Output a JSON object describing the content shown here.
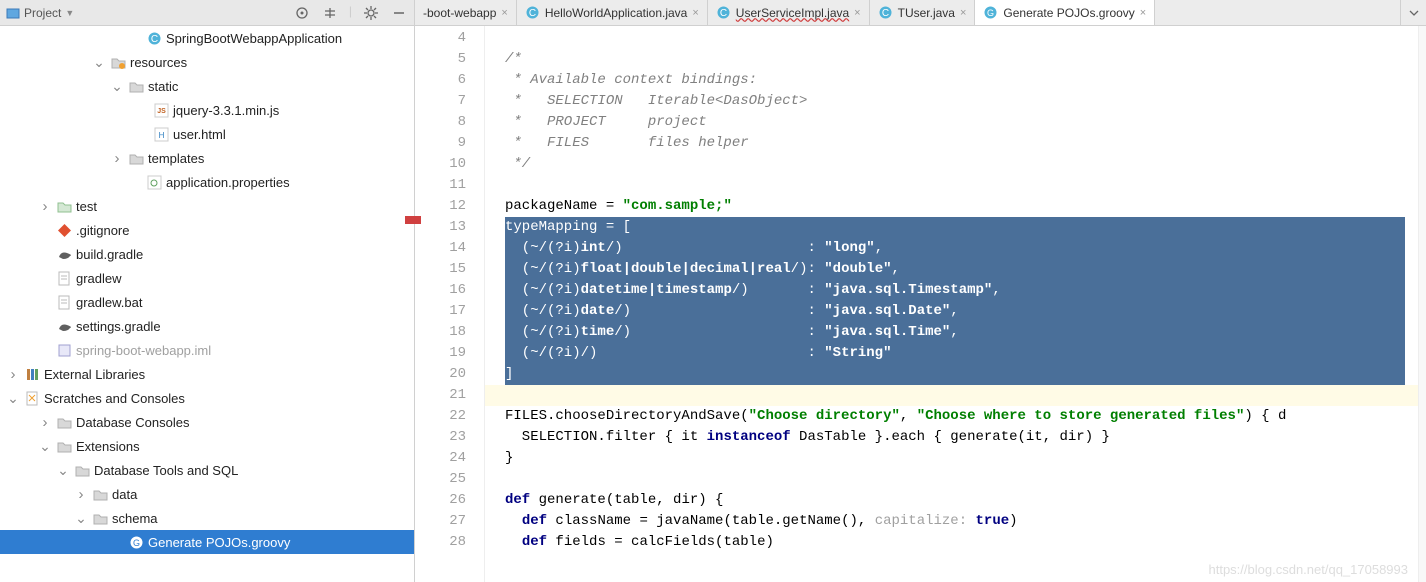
{
  "sidebar": {
    "title": "Project",
    "tree": [
      {
        "depth": 7,
        "icon": "class",
        "label": "SpringBootWebappApplication",
        "chevron": ""
      },
      {
        "depth": 5,
        "icon": "folder-res",
        "label": "resources",
        "chevron": "down"
      },
      {
        "depth": 6,
        "icon": "folder",
        "label": "static",
        "chevron": "down"
      },
      {
        "depth": 8,
        "icon": "js",
        "label": "jquery-3.3.1.min.js",
        "chevron": ""
      },
      {
        "depth": 8,
        "icon": "html",
        "label": "user.html",
        "chevron": ""
      },
      {
        "depth": 6,
        "icon": "folder",
        "label": "templates",
        "chevron": "right"
      },
      {
        "depth": 7,
        "icon": "props",
        "label": "application.properties",
        "chevron": ""
      },
      {
        "depth": 2,
        "icon": "folder-test",
        "label": "test",
        "chevron": "right"
      },
      {
        "depth": 2,
        "icon": "gitignore",
        "label": ".gitignore",
        "chevron": ""
      },
      {
        "depth": 2,
        "icon": "gradle",
        "label": "build.gradle",
        "chevron": ""
      },
      {
        "depth": 2,
        "icon": "file",
        "label": "gradlew",
        "chevron": ""
      },
      {
        "depth": 2,
        "icon": "file",
        "label": "gradlew.bat",
        "chevron": ""
      },
      {
        "depth": 2,
        "icon": "gradle",
        "label": "settings.gradle",
        "chevron": ""
      },
      {
        "depth": 2,
        "icon": "iml",
        "label": "spring-boot-webapp.iml",
        "chevron": "",
        "dim": true
      },
      {
        "depth": "root",
        "icon": "lib",
        "label": "External Libraries",
        "chevron": "right"
      },
      {
        "depth": "root",
        "icon": "scratch",
        "label": "Scratches and Consoles",
        "chevron": "down"
      },
      {
        "depth": 2,
        "icon": "folder",
        "label": "Database Consoles",
        "chevron": "right"
      },
      {
        "depth": 2,
        "icon": "folder",
        "label": "Extensions",
        "chevron": "down"
      },
      {
        "depth": 3,
        "icon": "folder",
        "label": "Database Tools and SQL",
        "chevron": "down"
      },
      {
        "depth": 4,
        "icon": "folder",
        "label": "data",
        "chevron": "right"
      },
      {
        "depth": 4,
        "icon": "folder",
        "label": "schema",
        "chevron": "down"
      },
      {
        "depth": 6,
        "icon": "groovy",
        "label": "Generate POJOs.groovy",
        "chevron": "",
        "selected": true
      }
    ]
  },
  "tabs": [
    {
      "label": "-boot-webapp",
      "icon": "none",
      "partial": true
    },
    {
      "label": "HelloWorldApplication.java",
      "icon": "class"
    },
    {
      "label": "UserServiceImpl.java",
      "icon": "class",
      "redline": true
    },
    {
      "label": "TUser.java",
      "icon": "class"
    },
    {
      "label": "Generate POJOs.groovy",
      "icon": "groovy",
      "active": true
    }
  ],
  "code": {
    "startLine": 4,
    "lines": [
      {
        "n": 4,
        "html": ""
      },
      {
        "n": 5,
        "html": "<span class='cmt'>/*</span>"
      },
      {
        "n": 6,
        "html": "<span class='cmt'> * Available context bindings:</span>"
      },
      {
        "n": 7,
        "html": "<span class='cmt'> *   SELECTION   Iterable&lt;DasObject&gt;</span>"
      },
      {
        "n": 8,
        "html": "<span class='cmt'> *   PROJECT     project</span>"
      },
      {
        "n": 9,
        "html": "<span class='cmt'> *   FILES       files helper</span>"
      },
      {
        "n": 10,
        "html": "<span class='cmt'> */</span>"
      },
      {
        "n": 11,
        "html": ""
      },
      {
        "n": 12,
        "html": "packageName = <span class='str'>\"com.sample;\"</span>"
      },
      {
        "n": 13,
        "sel": true,
        "html": "typeMapping = ["
      },
      {
        "n": 14,
        "sel": true,
        "html": "  (~/(?i)<span class='kw'>int</span>/)                      : <span class='str'>\"long\"</span>,"
      },
      {
        "n": 15,
        "sel": true,
        "html": "  (~/(?i)<span class='kw'>float|double|decimal|real</span>/): <span class='str'>\"double\"</span>,"
      },
      {
        "n": 16,
        "sel": true,
        "html": "  (~/(?i)<span class='kw'>datetime|timestamp</span>/)       : <span class='str'>\"java.sql.Timestamp\"</span>,"
      },
      {
        "n": 17,
        "sel": true,
        "html": "  (~/(?i)<span class='kw'>date</span>/)                     : <span class='str'>\"java.sql.Date\"</span>,"
      },
      {
        "n": 18,
        "sel": true,
        "html": "  (~/(?i)<span class='kw'>time</span>/)                     : <span class='str'>\"java.sql.Time\"</span>,"
      },
      {
        "n": 19,
        "sel": true,
        "html": "  (~/(?i)/)                         : <span class='str'>\"String\"</span>"
      },
      {
        "n": 20,
        "sel": true,
        "html": "]"
      },
      {
        "n": 21,
        "cur": true,
        "html": ""
      },
      {
        "n": 22,
        "html": "FILES.chooseDirectoryAndSave(<span class='str'>\"Choose directory\"</span>, <span class='str'>\"Choose where to store generated files\"</span>) { d"
      },
      {
        "n": 23,
        "html": "  SELECTION.filter { it <span class='kw'>instanceof</span> DasTable }.each { generate(it, dir) }"
      },
      {
        "n": 24,
        "html": "}"
      },
      {
        "n": 25,
        "html": ""
      },
      {
        "n": 26,
        "html": "<span class='kw'>def</span> generate(table, dir) {"
      },
      {
        "n": 27,
        "html": "  <span class='kw'>def</span> className = javaName(table.getName(), <span class='hint'>capitalize:</span> <span class='kw'>true</span>)"
      },
      {
        "n": 28,
        "html": "  <span class='kw'>def</span> fields = calcFields(table)"
      }
    ]
  },
  "watermark": "https://blog.csdn.net/qq_17058993"
}
